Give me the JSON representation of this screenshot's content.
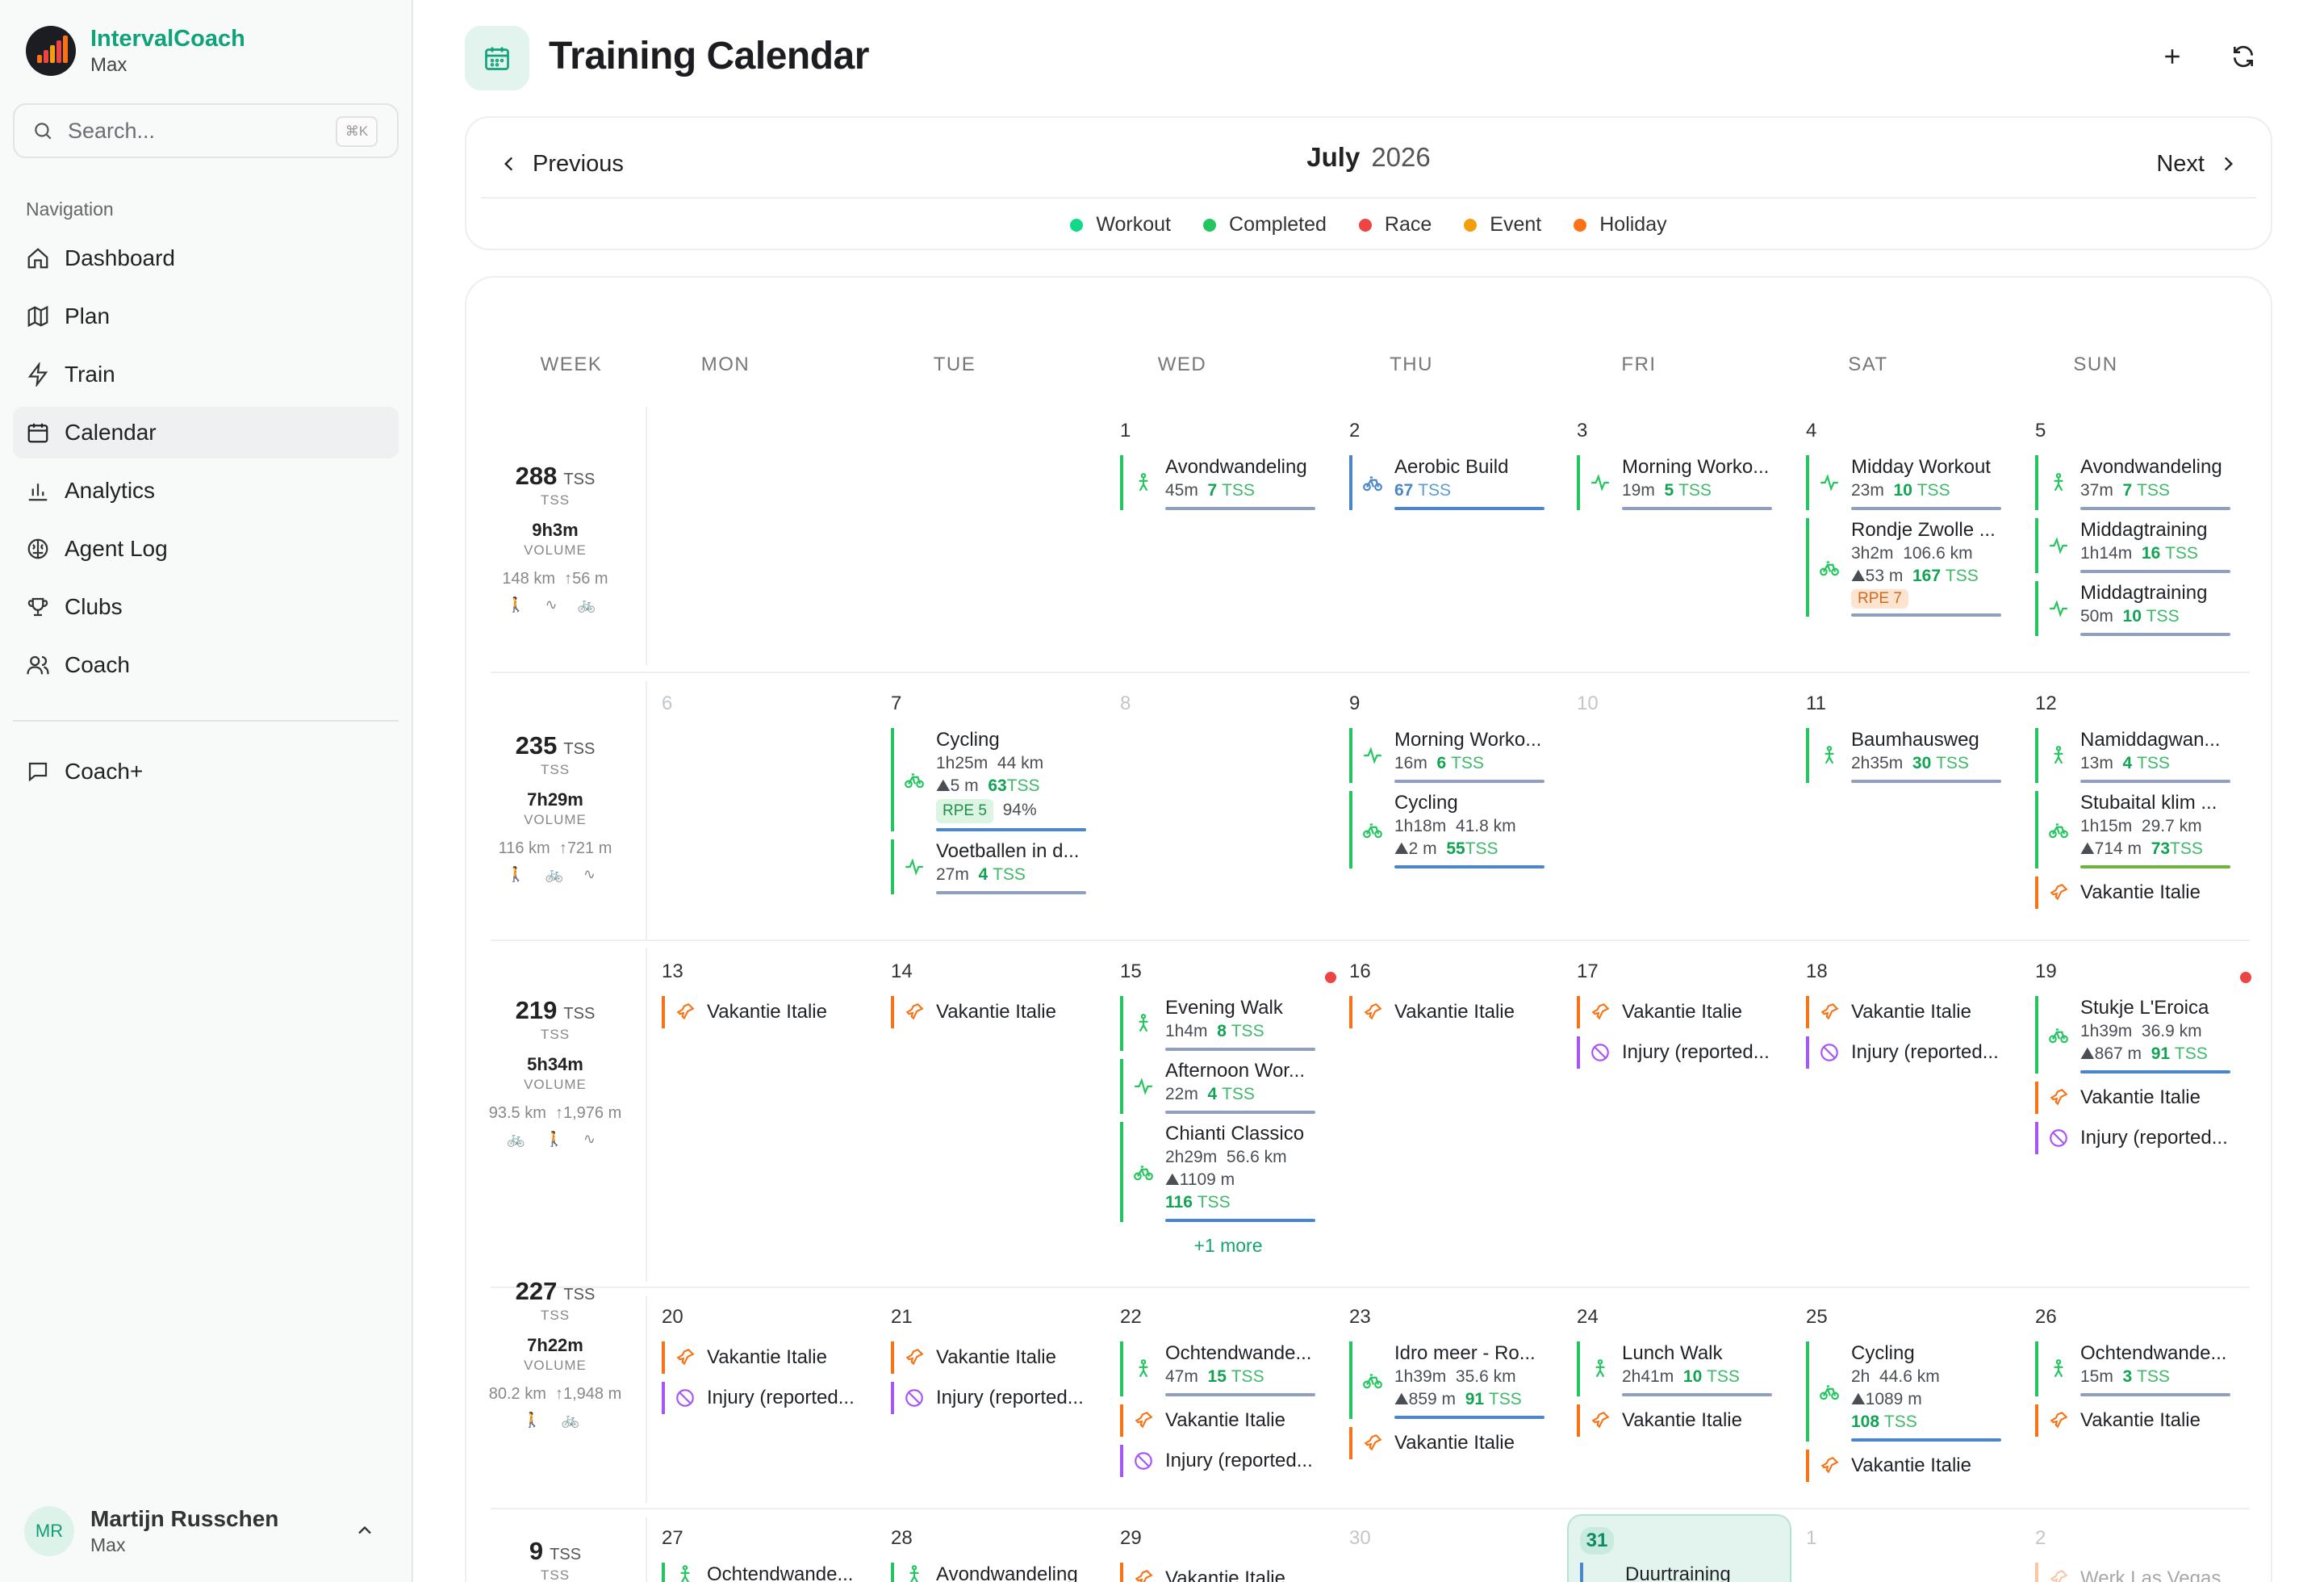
{
  "app": {
    "name": "IntervalCoach",
    "sub": "Max"
  },
  "search": {
    "placeholder": "Search...",
    "shortcut": "⌘K"
  },
  "sidebar": {
    "nav_label": "Navigation",
    "items": [
      {
        "label": "Dashboard",
        "icon": "home-icon"
      },
      {
        "label": "Plan",
        "icon": "map-icon"
      },
      {
        "label": "Train",
        "icon": "bolt-icon"
      },
      {
        "label": "Calendar",
        "icon": "calendar-icon",
        "active": true
      },
      {
        "label": "Analytics",
        "icon": "bar-chart-icon"
      },
      {
        "label": "Agent Log",
        "icon": "brain-icon"
      },
      {
        "label": "Clubs",
        "icon": "trophy-icon"
      },
      {
        "label": "Coach",
        "icon": "users-icon"
      }
    ],
    "extra": "Coach+"
  },
  "user": {
    "initials": "MR",
    "name": "Martijn Russchen",
    "sub": "Max"
  },
  "page": {
    "title": "Training Calendar"
  },
  "calnav": {
    "prev": "Previous",
    "next": "Next",
    "month": "July",
    "year": "2026"
  },
  "legend": [
    {
      "label": "Workout",
      "color": "#10d98a"
    },
    {
      "label": "Completed",
      "color": "#22c55e"
    },
    {
      "label": "Race",
      "color": "#ef4444"
    },
    {
      "label": "Event",
      "color": "#f59e0b"
    },
    {
      "label": "Holiday",
      "color": "#f97316"
    }
  ],
  "headers": [
    "WEEK",
    "MON",
    "TUE",
    "WED",
    "THU",
    "FRI",
    "SAT",
    "SUN"
  ],
  "weeks": [
    {
      "tss": "288",
      "tss_unit": "TSS",
      "tss_label": "TSS",
      "volume": "9h3m",
      "volume_label": "VOLUME",
      "dist": "148 km",
      "elev": "↑56 m",
      "sports": "🚶 ∿ 🚲"
    },
    {
      "tss": "235",
      "tss_unit": "TSS",
      "tss_label": "TSS",
      "volume": "7h29m",
      "volume_label": "VOLUME",
      "dist": "116 km",
      "elev": "↑721 m",
      "sports": "🚶 🚲 ∿"
    },
    {
      "tss": "219",
      "tss_unit": "TSS",
      "tss_label": "TSS",
      "volume": "5h34m",
      "volume_label": "VOLUME",
      "dist": "93.5 km",
      "elev": "↑1,976 m",
      "sports": "🚲 🚶 ∿"
    },
    {
      "tss": "227",
      "tss_unit": "TSS",
      "tss_label": "TSS",
      "volume": "7h22m",
      "volume_label": "VOLUME",
      "dist": "80.2 km",
      "elev": "↑1,948 m",
      "sports": "🚶 🚲"
    },
    {
      "tss": "9",
      "tss_unit": "TSS",
      "tss_label": "TSS"
    }
  ],
  "days": {
    "d1": "1",
    "d2": "2",
    "d3": "3",
    "d4": "4",
    "d5": "5",
    "d6": "6",
    "d7": "7",
    "d8": "8",
    "d9": "9",
    "d10": "10",
    "d11": "11",
    "d12": "12",
    "d13": "13",
    "d14": "14",
    "d15": "15",
    "d16": "16",
    "d17": "17",
    "d18": "18",
    "d19": "19",
    "d20": "20",
    "d21": "21",
    "d22": "22",
    "d23": "23",
    "d24": "24",
    "d25": "25",
    "d26": "26",
    "d27": "27",
    "d28": "28",
    "d29": "29",
    "d30": "30",
    "d31": "31",
    "n1": "1",
    "n2": "2"
  },
  "acts": {
    "a1": {
      "name": "Avondwandeling",
      "dur": "45m",
      "tss": "7",
      "u": "TSS"
    },
    "a2": {
      "name": "Aerobic Build",
      "tss": "67",
      "u": "TSS"
    },
    "a3": {
      "name": "Morning Worko...",
      "dur": "19m",
      "tss": "5",
      "u": "TSS"
    },
    "a4": {
      "name": "Midday Workout",
      "dur": "23m",
      "tss": "10",
      "u": "TSS"
    },
    "a5": {
      "name": "Rondje Zwolle ...",
      "dur": "3h2m",
      "dist": "106.6 km",
      "elev": "⛰53 m",
      "tss": "167",
      "u": "TSS",
      "rpe": "RPE 7"
    },
    "a6": {
      "name": "Avondwandeling",
      "dur": "37m",
      "tss": "7",
      "u": "TSS"
    },
    "a7": {
      "name": "Middagtraining",
      "dur": "1h14m",
      "tss": "16",
      "u": "TSS"
    },
    "a8": {
      "name": "Middagtraining",
      "dur": "50m",
      "tss": "10",
      "u": "TSS"
    },
    "b1": {
      "name": "Cycling",
      "dur": "1h25m",
      "dist": "44 km",
      "elev": "⛰5 m",
      "tss": "63",
      "u": "TSS",
      "rpe": "RPE 5",
      "pct": "94%"
    },
    "b2": {
      "name": "Voetballen in d...",
      "dur": "27m",
      "tss": "4",
      "u": "TSS"
    },
    "b3": {
      "name": "Morning Worko...",
      "dur": "16m",
      "tss": "6",
      "u": "TSS"
    },
    "b4": {
      "name": "Cycling",
      "dur": "1h18m",
      "dist": "41.8 km",
      "elev": "⛰2 m",
      "tss": "55",
      "u": "TSS"
    },
    "b5": {
      "name": "Baumhausweg",
      "dur": "2h35m",
      "tss": "30",
      "u": "TSS"
    },
    "b6": {
      "name": "Namiddagwan...",
      "dur": "13m",
      "tss": "4",
      "u": "TSS"
    },
    "b7": {
      "name": "Stubaital klim ...",
      "dur": "1h15m",
      "dist": "29.7 km",
      "elev": "⛰714 m",
      "tss": "73",
      "u": "TSS"
    },
    "c1": {
      "name": "Evening Walk",
      "dur": "1h4m",
      "tss": "8",
      "u": "TSS"
    },
    "c2": {
      "name": "Afternoon Wor...",
      "dur": "22m",
      "tss": "4",
      "u": "TSS"
    },
    "c3": {
      "name": "Chianti Classico",
      "dur": "2h29m",
      "dist": "56.6 km",
      "elev": "⛰1109 m",
      "tss": "116",
      "u": "TSS"
    },
    "c4": {
      "name": "Stukje L'Eroica",
      "dur": "1h39m",
      "dist": "36.9 km",
      "elev": "⛰867 m",
      "tss": "91",
      "u": "TSS"
    },
    "e1": {
      "name": "Ochtendwande...",
      "dur": "47m",
      "tss": "15",
      "u": "TSS"
    },
    "e2": {
      "name": "Idro meer - Ro...",
      "dur": "1h39m",
      "dist": "35.6 km",
      "elev": "⛰859 m",
      "tss": "91",
      "u": "TSS"
    },
    "e3": {
      "name": "Lunch Walk",
      "dur": "2h41m",
      "tss": "10",
      "u": "TSS"
    },
    "e4": {
      "name": "Cycling",
      "dur": "2h",
      "dist": "44.6 km",
      "elev": "⛰1089 m",
      "tss": "108",
      "u": "TSS"
    },
    "e5": {
      "name": "Ochtendwande...",
      "dur": "15m",
      "tss": "3",
      "u": "TSS"
    },
    "f1": {
      "name": "Ochtendwande..."
    },
    "f2": {
      "name": "Avondwandeling"
    },
    "f3": {
      "name": "Duurtraining"
    }
  },
  "events": {
    "holiday": "Vakantie Italie",
    "injury": "Injury (reported...",
    "vegas": "Werk Las Vegas"
  },
  "more": "+1 more",
  "colors": {
    "accent": "#10a37a",
    "completed": "#22c55e",
    "holiday": "#f97316",
    "injury": "#a855f7",
    "race": "#ef4444",
    "planned": "#4a86c8"
  }
}
